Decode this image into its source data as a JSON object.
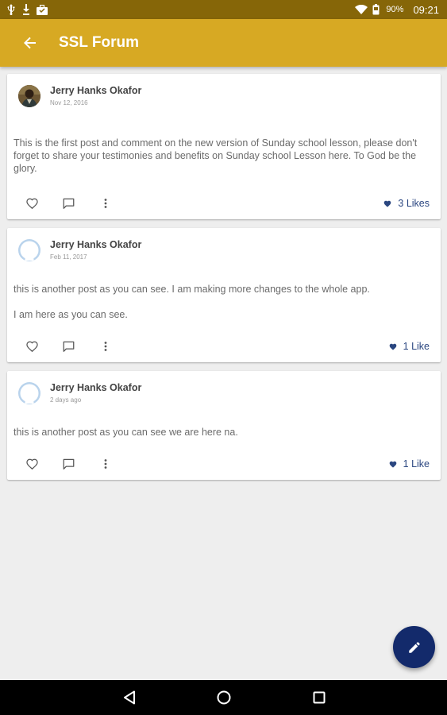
{
  "status_bar": {
    "battery_percent": "90%",
    "time": "09:21"
  },
  "app_bar": {
    "title": "SSL Forum"
  },
  "posts": [
    {
      "author": "Jerry Hanks Okafor",
      "date": "Nov 12, 2016",
      "avatar": "photo",
      "paragraphs": [
        "This is the first post and comment on the new version of Sunday school lesson,  please don't forget to share your testimonies and benefits on Sunday school Lesson here. To God be the glory."
      ],
      "likes_label": "3 Likes"
    },
    {
      "author": "Jerry Hanks Okafor",
      "date": "Feb 11, 2017",
      "avatar": "placeholder",
      "paragraphs": [
        "this is another post as you can see. I am making more changes to the whole app.",
        "I am here as you can see."
      ],
      "likes_label": "1 Like"
    },
    {
      "author": "Jerry Hanks Okafor",
      "date": "2 days ago",
      "avatar": "placeholder",
      "paragraphs": [
        "this is another post as you can see we are here na."
      ],
      "likes_label": "1 Like"
    }
  ],
  "colors": {
    "app_bar": "#d7a923",
    "status_bar": "#866608",
    "fab": "#132a6b",
    "like_text": "#2a4680"
  },
  "icons": {
    "back": "arrow-back-icon",
    "like": "heart-outline-icon",
    "comment": "comment-icon",
    "more": "more-vert-icon",
    "likes": "heart-filled-icon",
    "fab": "pencil-icon"
  }
}
